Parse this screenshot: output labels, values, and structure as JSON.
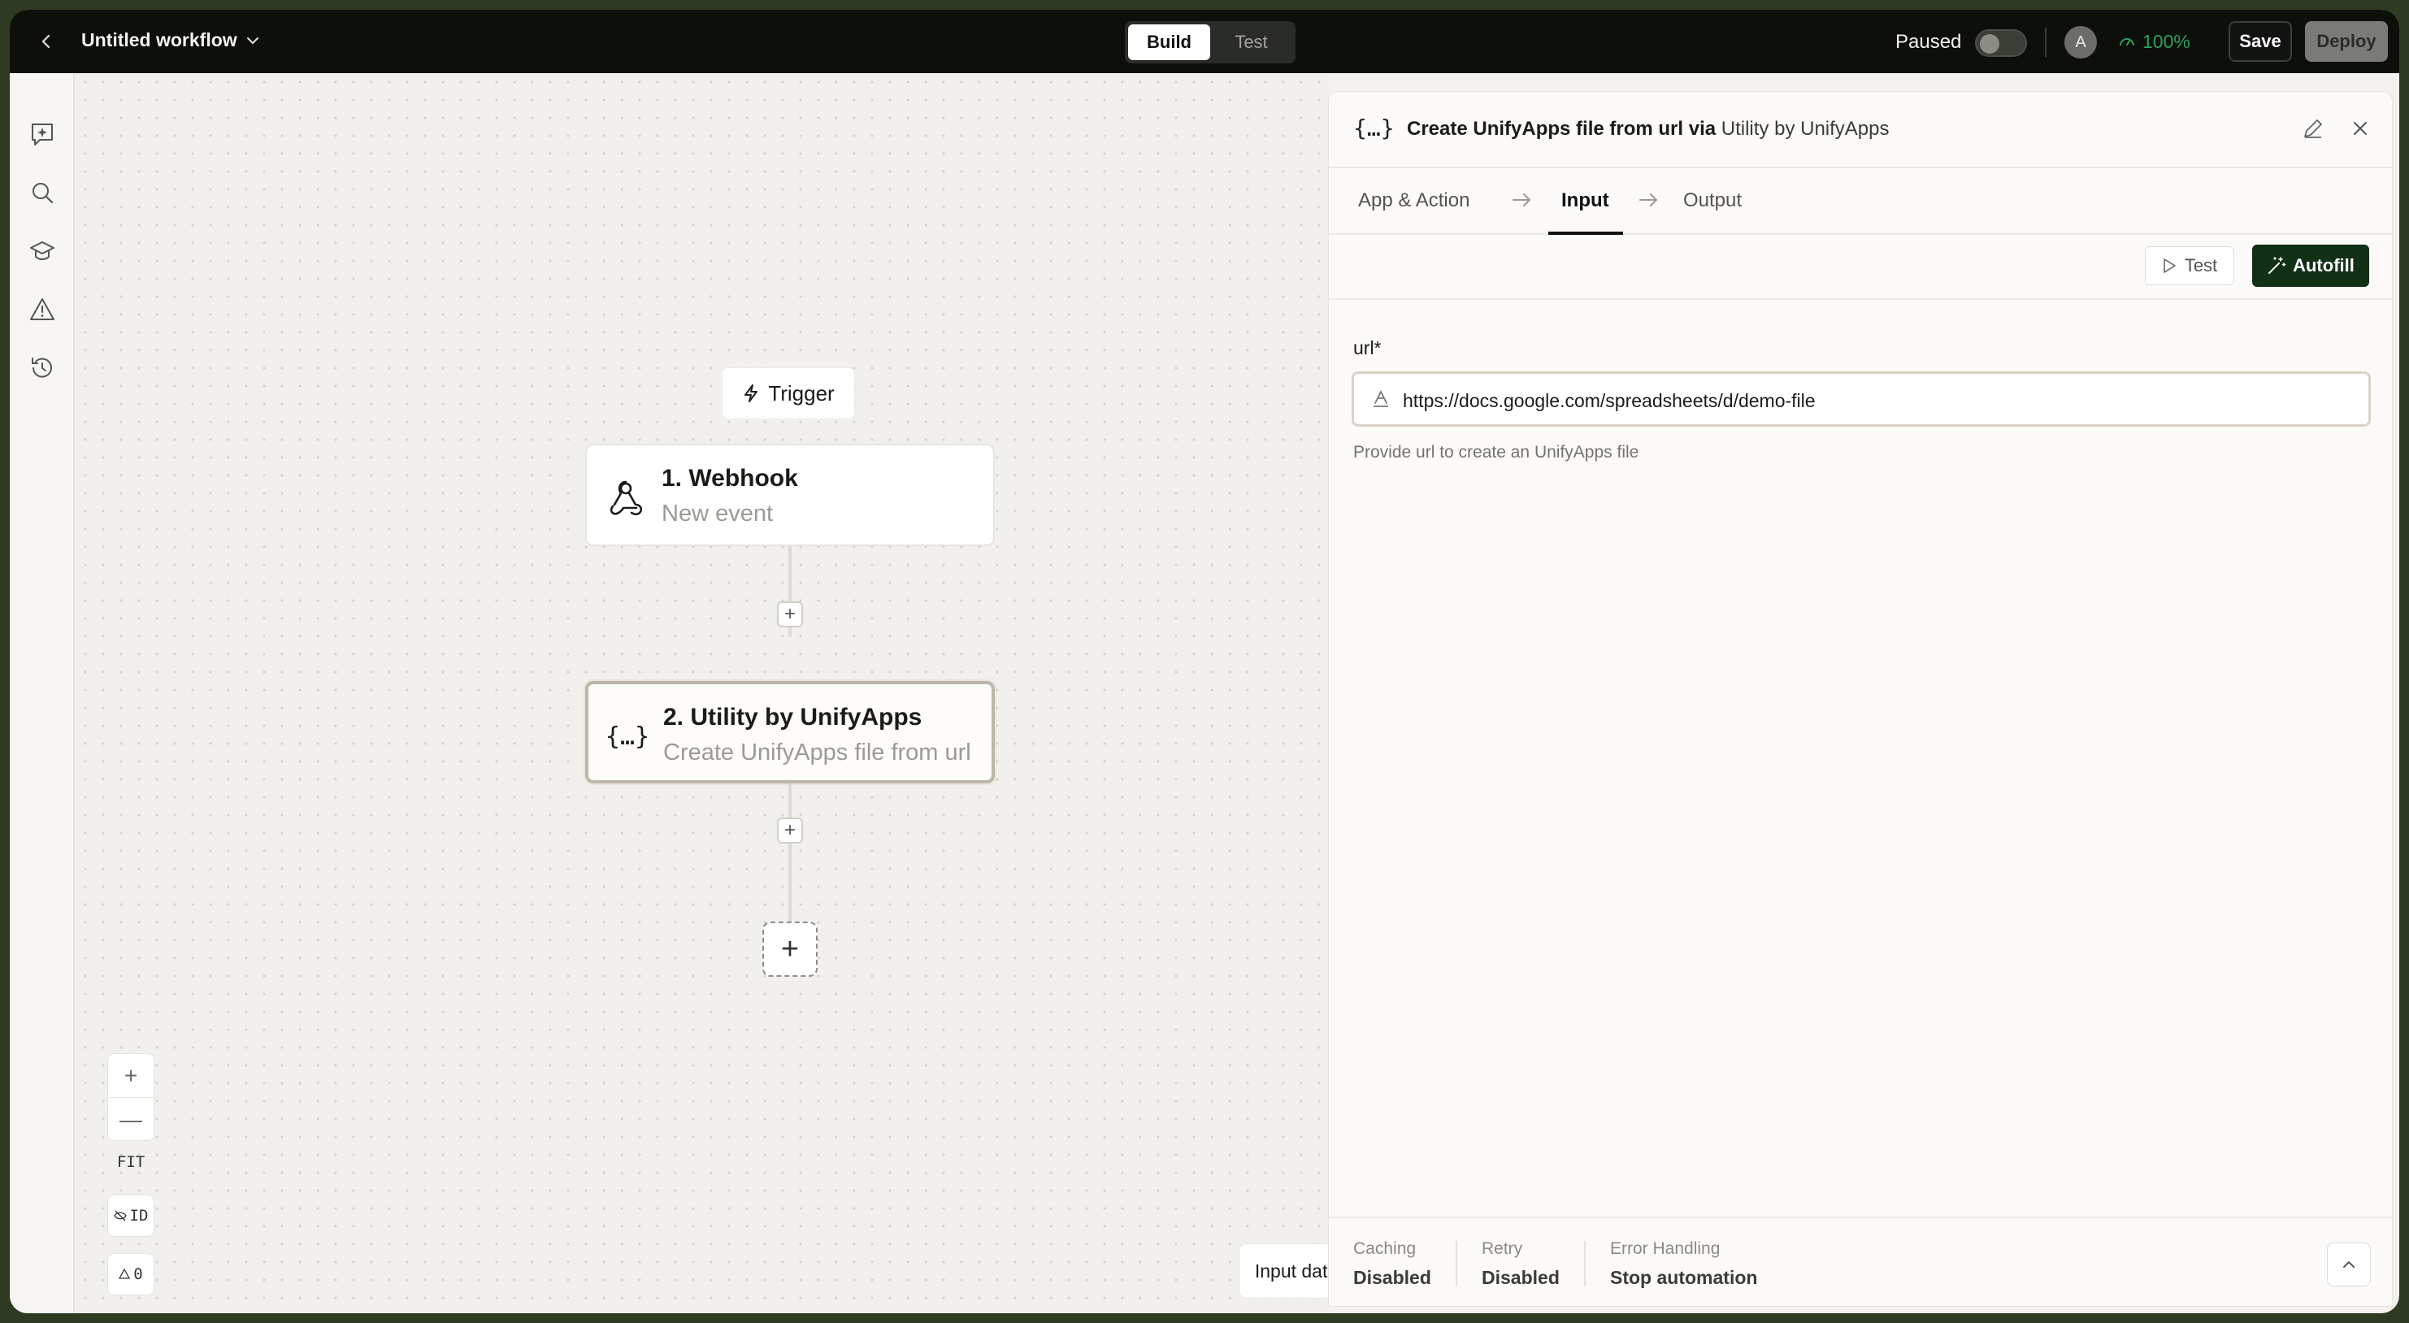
{
  "topbar": {
    "workflow_title": "Untitled workflow",
    "modes": [
      {
        "label": "Build",
        "active": true
      },
      {
        "label": "Test",
        "active": false
      }
    ],
    "status_label": "Paused",
    "avatar_initial": "A",
    "health": "100%",
    "save_label": "Save",
    "deploy_label": "Deploy"
  },
  "rail": {
    "icons": [
      "ai-assistant-icon",
      "search-icon",
      "learn-icon",
      "warning-icon",
      "history-icon"
    ]
  },
  "canvas": {
    "trigger_label": "Trigger",
    "nodes": [
      {
        "title": "1. Webhook",
        "subtitle": "New event",
        "icon": "webhook-icon"
      },
      {
        "title": "2. Utility by UnifyApps",
        "subtitle": "Create UnifyApps file from url",
        "icon": "braces-icon"
      }
    ],
    "controls": {
      "zoom_in": "+",
      "zoom_out": "—",
      "fit": "FIT",
      "id_toggle": "ID",
      "warnings": "0"
    },
    "input_data_label": "Input data"
  },
  "panel": {
    "icon": "{…}",
    "title": "Create UnifyApps file from url via ",
    "title_app": "Utility by UnifyApps",
    "tabs": [
      {
        "label": "App & Action",
        "active": false
      },
      {
        "label": "Input",
        "active": true
      },
      {
        "label": "Output",
        "active": false
      }
    ],
    "test_label": "Test",
    "autofill_label": "Autofill",
    "field": {
      "label": "url*",
      "value": "https://docs.google.com/spreadsheets/d/demo-file",
      "help": "Provide url to create an UnifyApps file"
    },
    "footer": [
      {
        "key": "Caching",
        "value": "Disabled"
      },
      {
        "key": "Retry",
        "value": "Disabled"
      },
      {
        "key": "Error Handling",
        "value": "Stop automation"
      }
    ]
  },
  "colors": {
    "topbar_bg": "#0d0f0b",
    "accent_green": "#123016",
    "health_green": "#2f9e5c"
  }
}
